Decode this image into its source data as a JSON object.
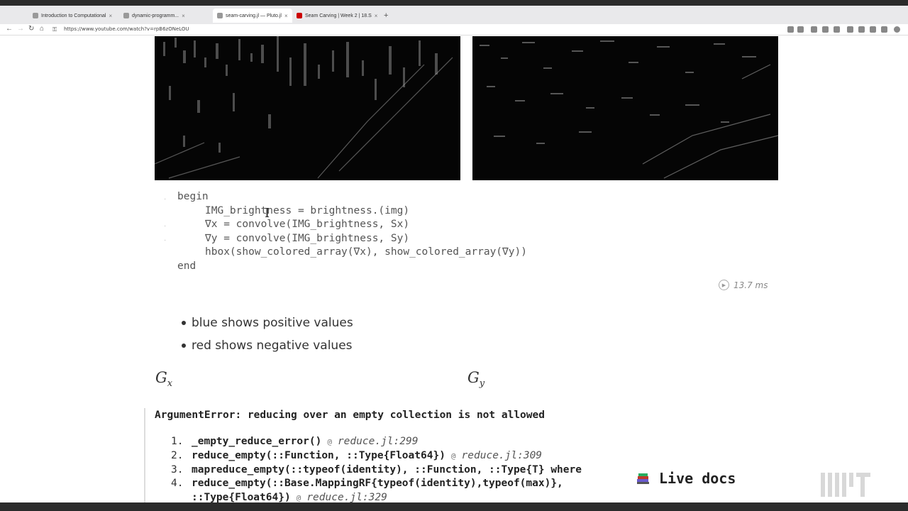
{
  "browser": {
    "tabs": [
      {
        "title": "Introduction to Computational"
      },
      {
        "title": "dynamic-programm..."
      },
      {
        "title": "seam-carving.jl — Pluto.jl"
      },
      {
        "title": "Seam Carving | Week 2 | 18.S"
      }
    ],
    "url": "https://www.youtube.com/watch?v=rpB6zONeLOU"
  },
  "code": {
    "lines": [
      "begin",
      "IMG_brightness = brightness.(img)",
      "∇x = convolve(IMG_brightness, Sx)",
      "∇y = convolve(IMG_brightness, Sy)",
      "hbox(show_colored_array(∇x), show_colored_array(∇y))",
      "end"
    ],
    "runtime": "13.7 ms"
  },
  "bullets": [
    "blue shows positive values",
    "red shows negative values"
  ],
  "math": {
    "gx": "G",
    "gx_sub": "x",
    "gy": "G",
    "gy_sub": "y"
  },
  "error": {
    "title": "ArgumentError: reducing over an empty collection is not allowed",
    "trace": [
      {
        "num": "1.",
        "fn": "_empty_reduce_error()",
        "file": "reduce.jl:299"
      },
      {
        "num": "2.",
        "fn": "reduce_empty(::Function, ::Type{Float64})",
        "file": "reduce.jl:309"
      },
      {
        "num": "3.",
        "fn": "mapreduce_empty(::typeof(identity), ::Function, ::Type{T} where",
        "file": ""
      },
      {
        "num": "4.",
        "fn": "reduce_empty(::Base.MappingRF{typeof(identity),typeof(max)},",
        "file": ""
      }
    ],
    "trace_cont": {
      "fn": "::Type{Float64})",
      "file": "reduce.jl:329"
    }
  },
  "live_docs": {
    "label": "Live docs"
  }
}
